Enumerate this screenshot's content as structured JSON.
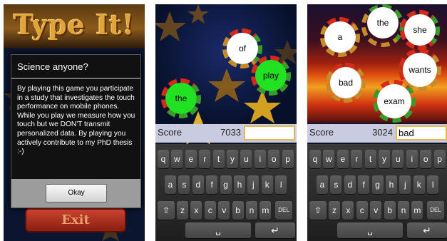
{
  "panel1": {
    "title": "Type It!",
    "dialog": {
      "title": "Science anyone?",
      "body": "By playing this game you participate in a study that investigates the touch performance on mobile phones. While you play we measure how you touch but we DON'T transmit personalized data. By playing you actively contribute to my PhD thesis :-)",
      "ok_label": "Okay"
    },
    "exit_label": "Exit"
  },
  "panel2": {
    "score_label": "Score",
    "score_value": "7033",
    "input_value": "",
    "words": [
      {
        "text": "of",
        "style": "white"
      },
      {
        "text": "play",
        "style": "green"
      },
      {
        "text": "the",
        "style": "green"
      }
    ]
  },
  "panel3": {
    "score_label": "Score",
    "score_value": "3024",
    "input_value": "bad",
    "words": [
      {
        "text": "a",
        "style": "white"
      },
      {
        "text": "the",
        "style": "white"
      },
      {
        "text": "she",
        "style": "white"
      },
      {
        "text": "wants",
        "style": "white"
      },
      {
        "text": "bad",
        "style": "white"
      },
      {
        "text": "exam",
        "style": "white"
      }
    ]
  },
  "keyboard": {
    "row1": [
      "q",
      "w",
      "e",
      "r",
      "t",
      "y",
      "u",
      "i",
      "o",
      "p"
    ],
    "row2": [
      "a",
      "s",
      "d",
      "f",
      "g",
      "h",
      "j",
      "k",
      "l"
    ],
    "row3": [
      "z",
      "x",
      "c",
      "v",
      "b",
      "n",
      "m"
    ],
    "del_label": "DEL",
    "space_label": "␣",
    "enter_label": "↵"
  },
  "colors": {
    "dialog_bg": "#111111",
    "green_word": "#22e022",
    "input_border": "#e8b84a",
    "score_bar": "#c9cce0"
  }
}
